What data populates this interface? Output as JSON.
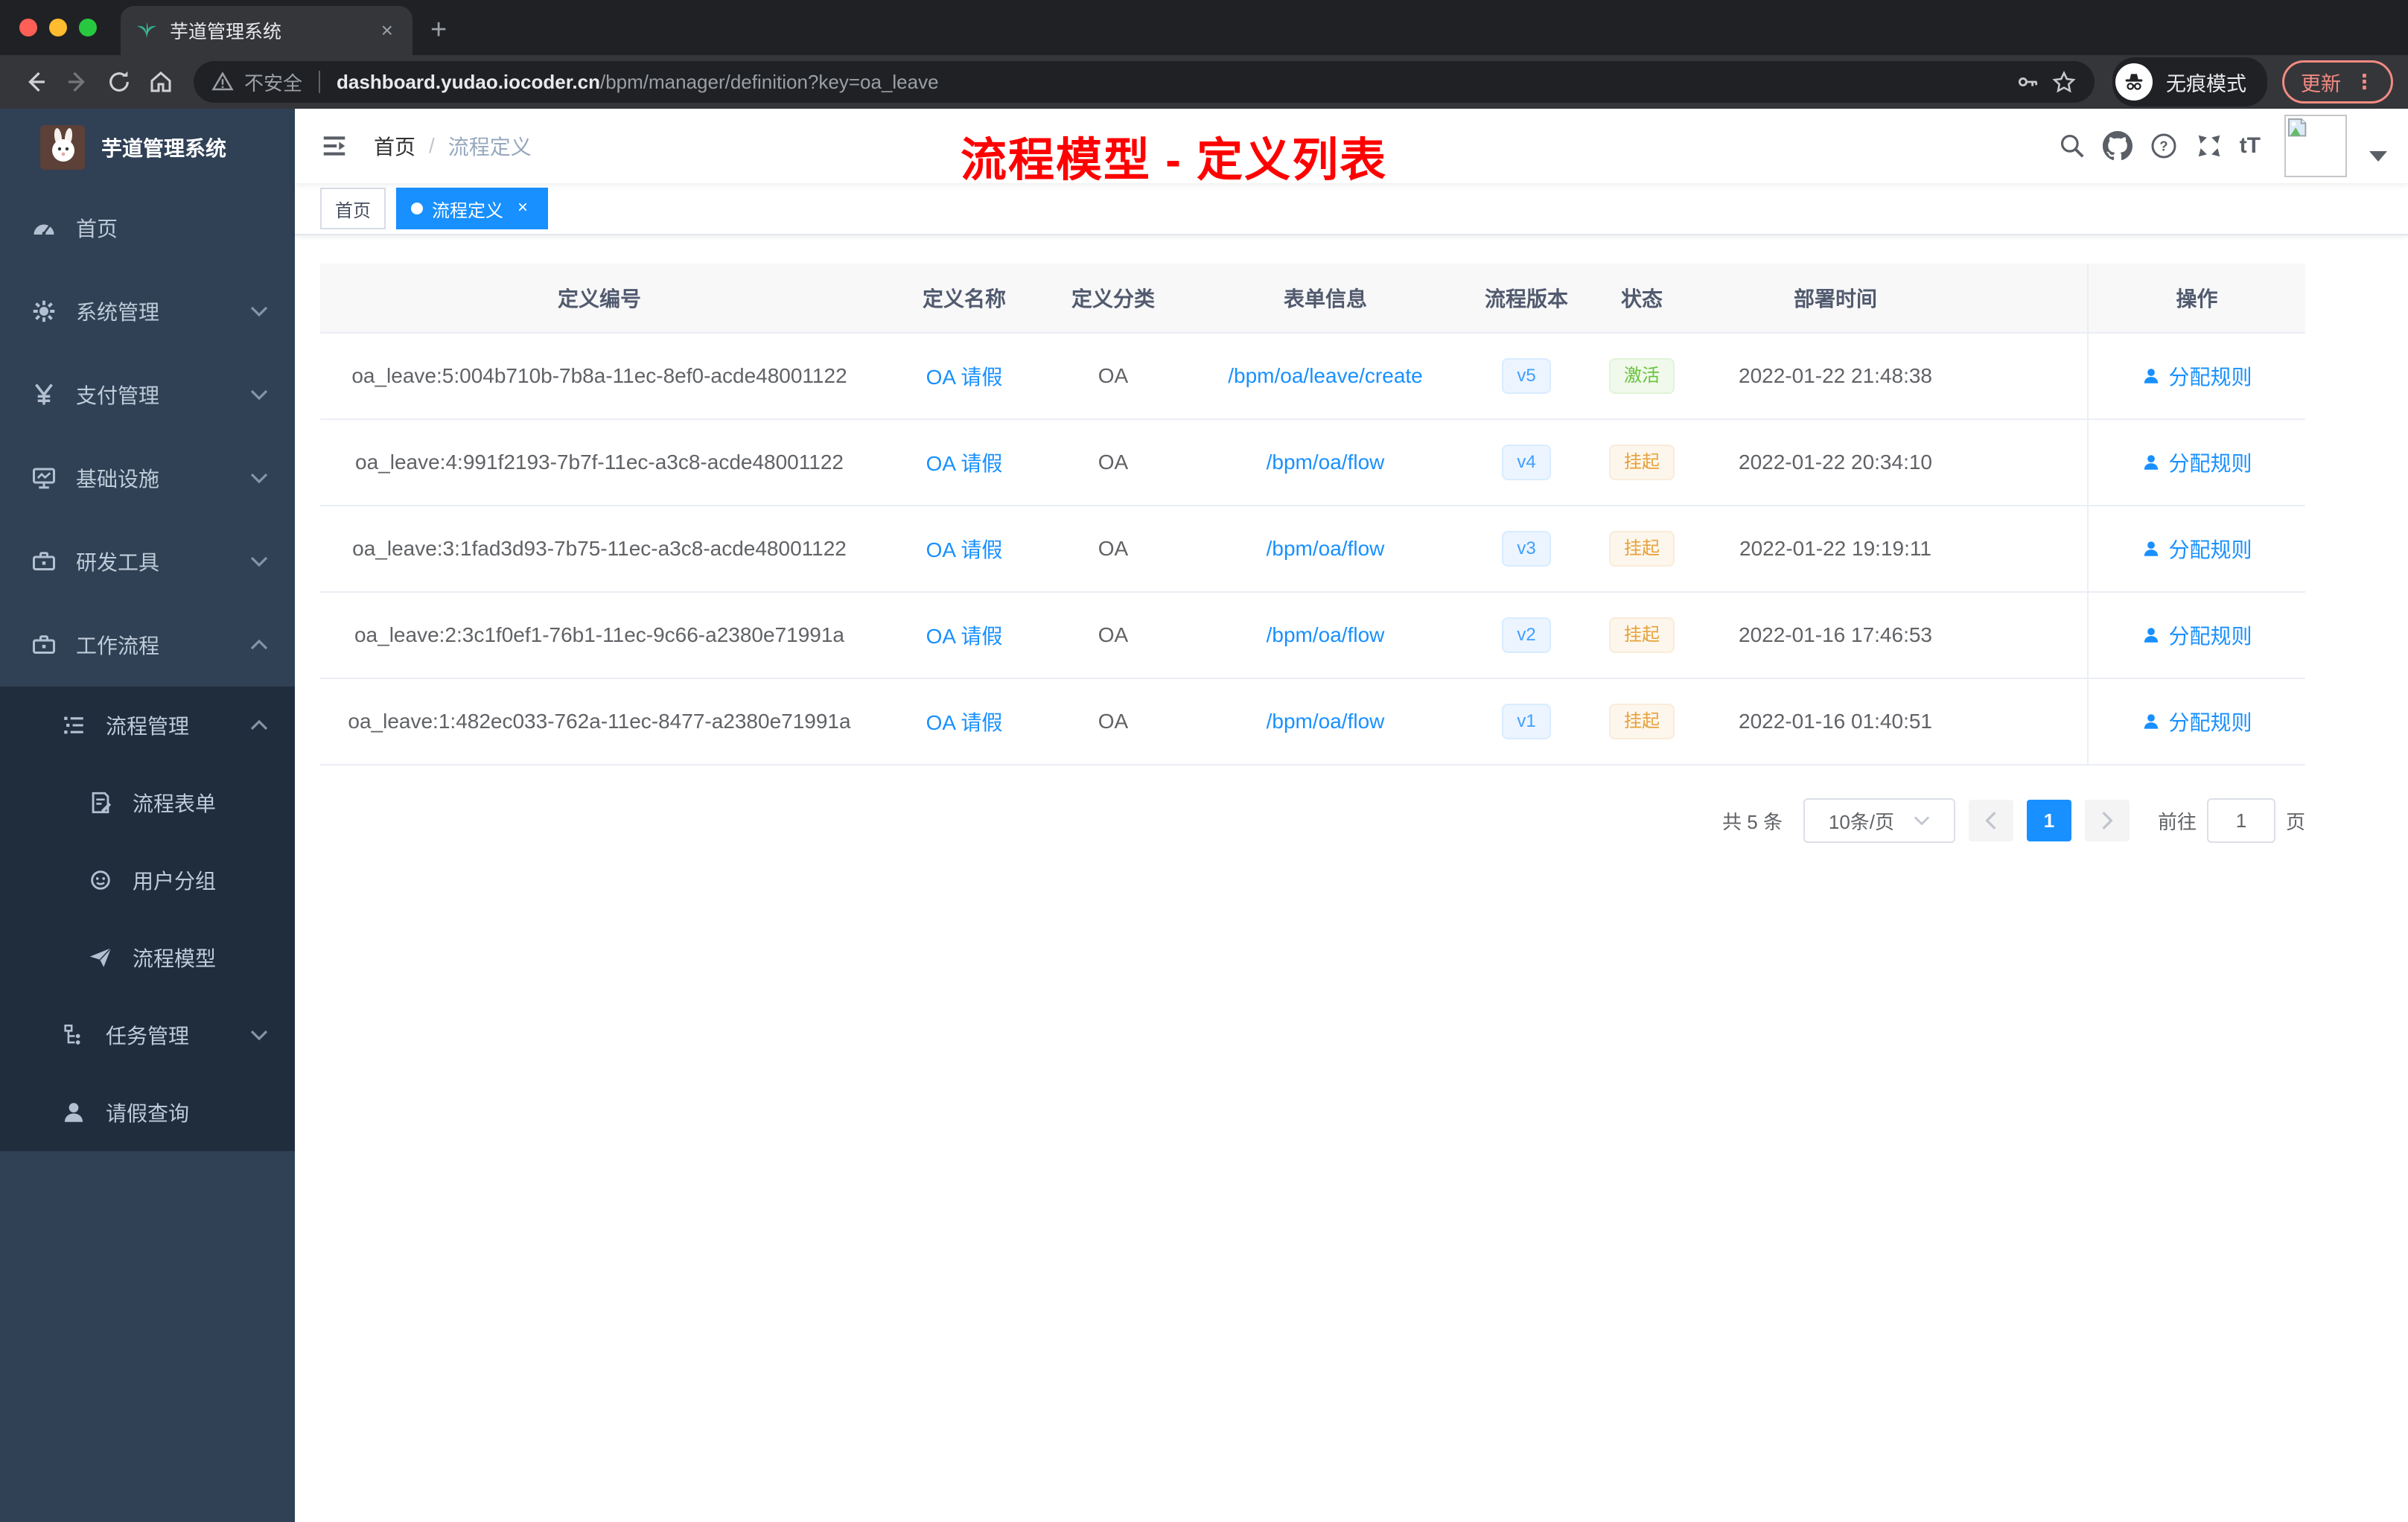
{
  "browser": {
    "tab_title": "芋道管理系统",
    "new_tab": "+",
    "security_label": "不安全",
    "url_domain": "dashboard.yudao.iocoder.cn",
    "url_path": "/bpm/manager/definition?key=oa_leave",
    "incognito_label": "无痕模式",
    "update_label": "更新",
    "update_dots": "⋮",
    "tab_close": "×"
  },
  "sidebar": {
    "app_title": "芋道管理系统",
    "items": [
      {
        "label": "首页",
        "icon": "dashboard-icon"
      },
      {
        "label": "系统管理",
        "icon": "gear-icon",
        "chevron": "down"
      },
      {
        "label": "支付管理",
        "icon": "yuan-icon",
        "chevron": "down"
      },
      {
        "label": "基础设施",
        "icon": "monitor-icon",
        "chevron": "down"
      },
      {
        "label": "研发工具",
        "icon": "toolbox-icon",
        "chevron": "down"
      },
      {
        "label": "工作流程",
        "icon": "workflow-icon",
        "chevron": "up"
      }
    ],
    "workflow_submenu": {
      "groups": [
        {
          "label": "流程管理",
          "icon": "list-tree-icon",
          "chevron": "up",
          "children": [
            {
              "label": "流程表单",
              "icon": "form-icon"
            },
            {
              "label": "用户分组",
              "icon": "user-group-icon"
            },
            {
              "label": "流程模型",
              "icon": "paper-plane-icon"
            }
          ]
        },
        {
          "label": "任务管理",
          "icon": "org-tree-icon",
          "chevron": "down",
          "children": []
        },
        {
          "label": "请假查询",
          "icon": "person-icon",
          "children": []
        }
      ]
    }
  },
  "header": {
    "breadcrumb_home": "首页",
    "breadcrumb_sep": "/",
    "breadcrumb_current": "流程定义",
    "annotation": "流程模型 - 定义列表"
  },
  "tags": [
    {
      "label": "首页",
      "active": false
    },
    {
      "label": "流程定义",
      "active": true,
      "close": "×"
    }
  ],
  "table": {
    "columns": [
      "定义编号",
      "定义名称",
      "定义分类",
      "表单信息",
      "流程版本",
      "状态",
      "部署时间",
      "操作"
    ],
    "action_label": "分配规则",
    "rows": [
      {
        "id": "oa_leave:5:004b710b-7b8a-11ec-8ef0-acde48001122",
        "name": "OA 请假",
        "category": "OA",
        "form": "/bpm/oa/leave/create",
        "version": "v5",
        "status": {
          "label": "激活",
          "type": "success"
        },
        "deployed": "2022-01-22 21:48:38"
      },
      {
        "id": "oa_leave:4:991f2193-7b7f-11ec-a3c8-acde48001122",
        "name": "OA 请假",
        "category": "OA",
        "form": "/bpm/oa/flow",
        "version": "v4",
        "status": {
          "label": "挂起",
          "type": "warning"
        },
        "deployed": "2022-01-22 20:34:10"
      },
      {
        "id": "oa_leave:3:1fad3d93-7b75-11ec-a3c8-acde48001122",
        "name": "OA 请假",
        "category": "OA",
        "form": "/bpm/oa/flow",
        "version": "v3",
        "status": {
          "label": "挂起",
          "type": "warning"
        },
        "deployed": "2022-01-22 19:19:11"
      },
      {
        "id": "oa_leave:2:3c1f0ef1-76b1-11ec-9c66-a2380e71991a",
        "name": "OA 请假",
        "category": "OA",
        "form": "/bpm/oa/flow",
        "version": "v2",
        "status": {
          "label": "挂起",
          "type": "warning"
        },
        "deployed": "2022-01-16 17:46:53"
      },
      {
        "id": "oa_leave:1:482ec033-762a-11ec-8477-a2380e71991a",
        "name": "OA 请假",
        "category": "OA",
        "form": "/bpm/oa/flow",
        "version": "v1",
        "status": {
          "label": "挂起",
          "type": "warning"
        },
        "deployed": "2022-01-16 01:40:51"
      }
    ]
  },
  "pagination": {
    "total": "共 5 条",
    "page_size": "10条/页",
    "current_page": "1",
    "jump_prefix": "前往",
    "jump_value": "1",
    "jump_suffix": "页"
  },
  "colors": {
    "primary": "#1890ff",
    "sidebar_bg": "#304156",
    "submenu_bg": "#1f2d3d",
    "success": "#67c23a",
    "warning": "#e6a23c",
    "annotation_red": "#fe0000"
  }
}
